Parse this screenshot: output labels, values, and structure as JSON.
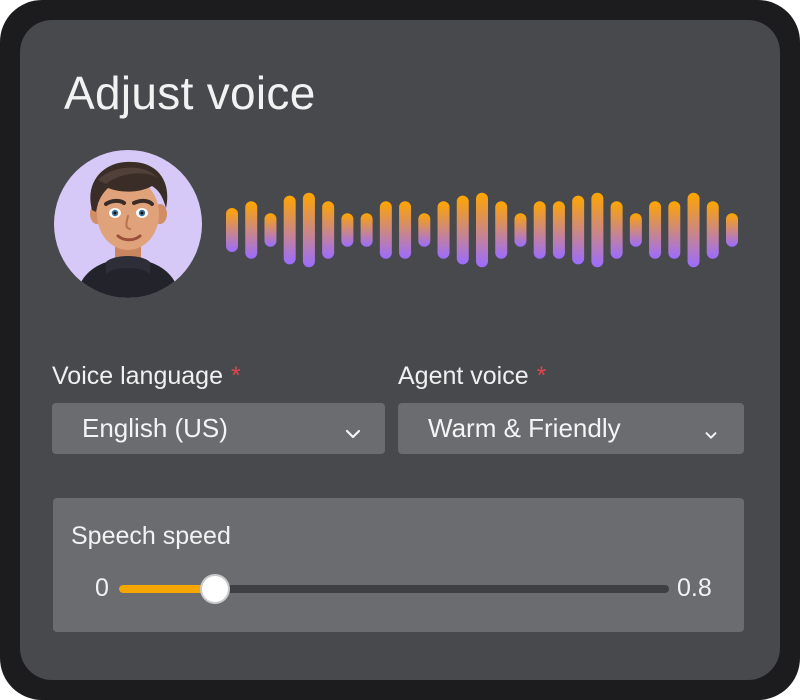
{
  "title": "Adjust voice",
  "colors": {
    "accent": "#f5a700",
    "wave_top": "#ffa500",
    "wave_bottom": "#9b6cff",
    "required": "#e0454d"
  },
  "avatar": {
    "icon": "person-avatar-icon"
  },
  "waveform": {
    "bars": [
      0.55,
      0.72,
      0.42,
      0.86,
      0.93,
      0.72,
      0.42,
      0.42,
      0.72,
      0.72,
      0.42,
      0.72,
      0.86,
      0.93,
      0.72,
      0.42,
      0.72,
      0.72,
      0.86,
      0.93,
      0.72,
      0.42,
      0.72,
      0.72,
      0.93,
      0.72,
      0.42
    ]
  },
  "voice_language": {
    "label": "Voice language",
    "required_mark": "*",
    "value": "English (US)",
    "icon": "chevron-down-icon"
  },
  "agent_voice": {
    "label": "Agent voice",
    "required_mark": "*",
    "value": "Warm & Friendly",
    "icon": "chevron-down-icon"
  },
  "speech_speed": {
    "label": "Speech speed",
    "min_label": "0",
    "max_label": "0.8",
    "min": 0,
    "max": 0.8,
    "value": 0.14
  }
}
